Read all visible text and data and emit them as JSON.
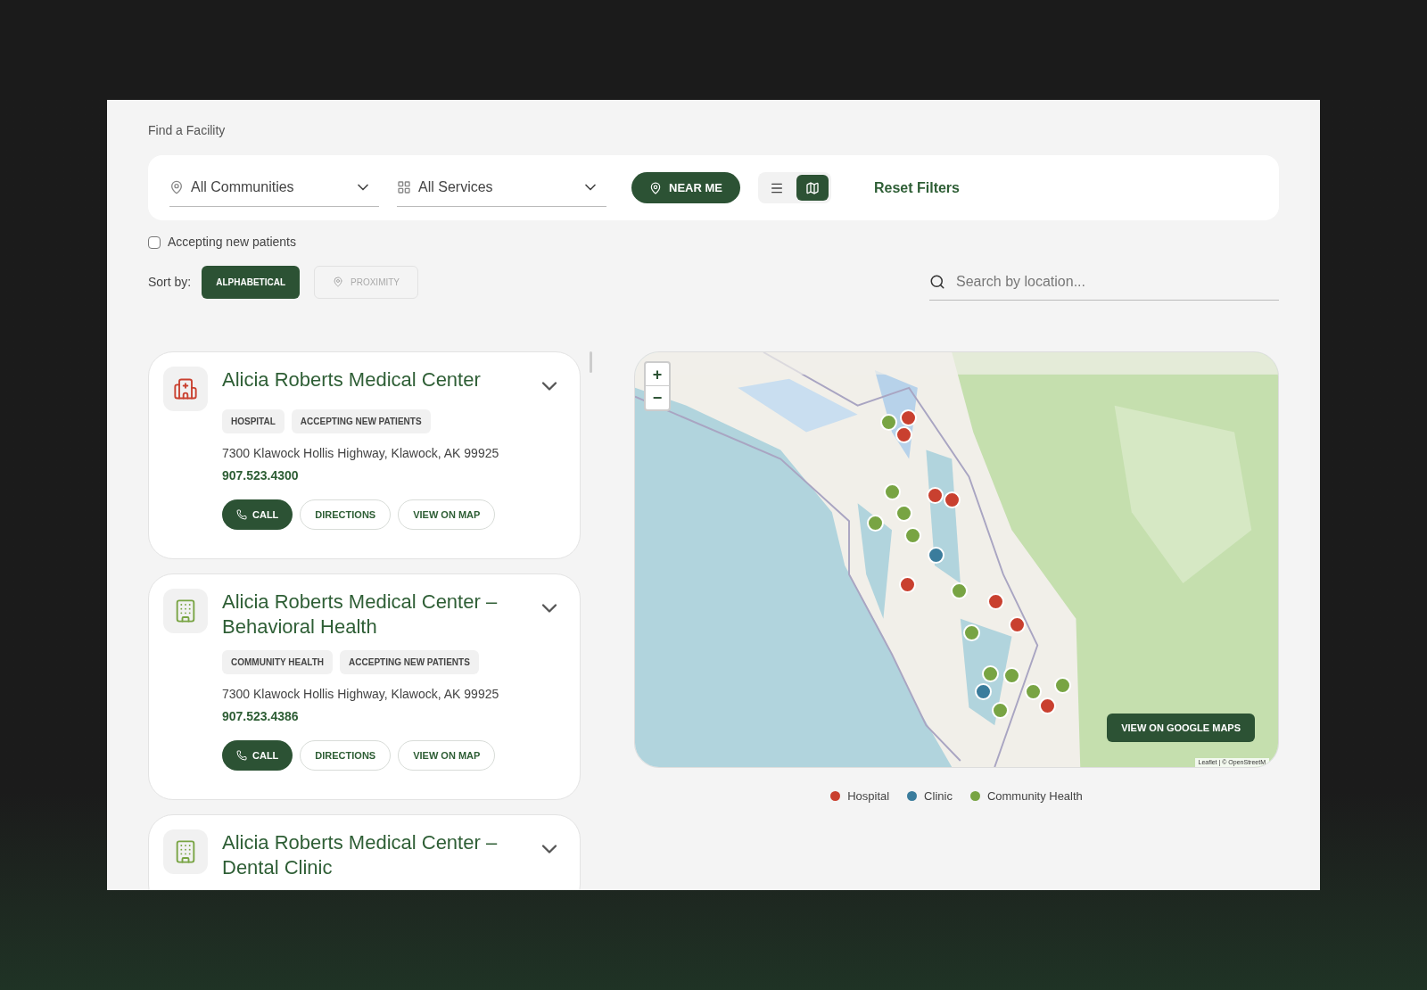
{
  "page": {
    "title": "Find a Facility"
  },
  "filters": {
    "community": {
      "value": "All Communities"
    },
    "service": {
      "value": "All Services"
    },
    "near_me": "NEAR ME",
    "view_modes": [
      {
        "kind": "list",
        "selected": false
      },
      {
        "kind": "map",
        "selected": true
      }
    ],
    "reset": "Reset Filters"
  },
  "accepting_new_patients": {
    "label": "Accepting new patients",
    "checked": false
  },
  "sort": {
    "label": "Sort by:",
    "options": [
      {
        "label": "ALPHABETICAL",
        "kind": "plain",
        "selected": true,
        "disabled": false
      },
      {
        "label": "PROXIMITY",
        "kind": "location",
        "selected": false,
        "disabled": true
      }
    ]
  },
  "search": {
    "placeholder": "Search by location..."
  },
  "facilities": [
    {
      "kind": "hospital",
      "name": "Alicia Roberts Medical Center",
      "tags": [
        "HOSPITAL",
        "ACCEPTING NEW PATIENTS"
      ],
      "address": "7300 Klawock Hollis Highway, Klawock, AK 99925",
      "phone": "907.523.4300",
      "actions": [
        {
          "kind": "call",
          "label": "CALL"
        },
        {
          "kind": "plain",
          "label": "DIRECTIONS"
        },
        {
          "kind": "plain",
          "label": "VIEW ON MAP"
        }
      ]
    },
    {
      "kind": "building",
      "name": "Alicia Roberts Medical Center – Behavioral Health",
      "tags": [
        "COMMUNITY HEALTH",
        "ACCEPTING NEW PATIENTS"
      ],
      "address": "7300 Klawock Hollis Highway, Klawock, AK 99925",
      "phone": "907.523.4386",
      "actions": [
        {
          "kind": "call",
          "label": "CALL"
        },
        {
          "kind": "plain",
          "label": "DIRECTIONS"
        },
        {
          "kind": "plain",
          "label": "VIEW ON MAP"
        }
      ]
    },
    {
      "kind": "building",
      "name": "Alicia Roberts Medical Center – Dental Clinic"
    }
  ],
  "map": {
    "zoom_in": "+",
    "zoom_out": "−",
    "google_button": "VIEW ON GOOGLE MAPS",
    "attribution": "Leaflet | © OpenStreetM",
    "markers": [
      {
        "color": "#78a443"
      },
      {
        "color": "#c9402f"
      },
      {
        "color": "#c9402f"
      },
      {
        "color": "#78a443"
      },
      {
        "color": "#c9402f"
      },
      {
        "color": "#c9402f"
      },
      {
        "color": "#78a443"
      },
      {
        "color": "#78a443"
      },
      {
        "color": "#78a443"
      },
      {
        "color": "#3a7c9c"
      },
      {
        "color": "#c9402f"
      },
      {
        "color": "#78a443"
      },
      {
        "color": "#c9402f"
      },
      {
        "color": "#c9402f"
      },
      {
        "color": "#78a443"
      },
      {
        "color": "#78a443"
      },
      {
        "color": "#78a443"
      },
      {
        "color": "#3a7c9c"
      },
      {
        "color": "#c9402f"
      },
      {
        "color": "#78a443"
      },
      {
        "color": "#78a443"
      },
      {
        "color": "#78a443"
      }
    ]
  },
  "legend": [
    {
      "label": "Hospital",
      "color": "#c9402f"
    },
    {
      "label": "Clinic",
      "color": "#3a7c9c"
    },
    {
      "label": "Community Health",
      "color": "#78a443"
    }
  ]
}
